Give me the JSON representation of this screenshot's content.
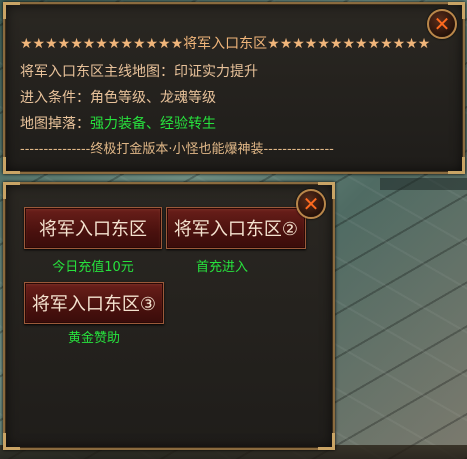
{
  "top_panel": {
    "title": "★★★★★★★★★★★★★将军入口东区★★★★★★★★★★★★★",
    "lines": [
      {
        "label": "将军入口东区主线地图：",
        "value": "印证实力提升",
        "value_color": "#e8c29a"
      },
      {
        "label": "进入条件：",
        "value": "角色等级、龙魂等级",
        "value_color": "#e8c29a"
      },
      {
        "label": "地图掉落：",
        "value": "强力装备、经验转生",
        "value_color": "#27e23d"
      }
    ],
    "footer": "---------------终极打金版本·小怪也能爆神装---------------",
    "close_icon": "✕"
  },
  "bottom_panel": {
    "close_icon": "✕",
    "buttons": [
      {
        "label": "将军入口东区",
        "caption": "今日充值10元"
      },
      {
        "label": "将军入口东区②",
        "caption": "首充进入"
      },
      {
        "label": "将军入口东区③",
        "caption": "黄金赞助"
      }
    ]
  },
  "colors": {
    "border": "#8a6b3f",
    "accent_text": "#f0b57a",
    "green_text": "#27e23d",
    "button_red": "#6a1f1a",
    "close_x": "#ff6a1f"
  }
}
